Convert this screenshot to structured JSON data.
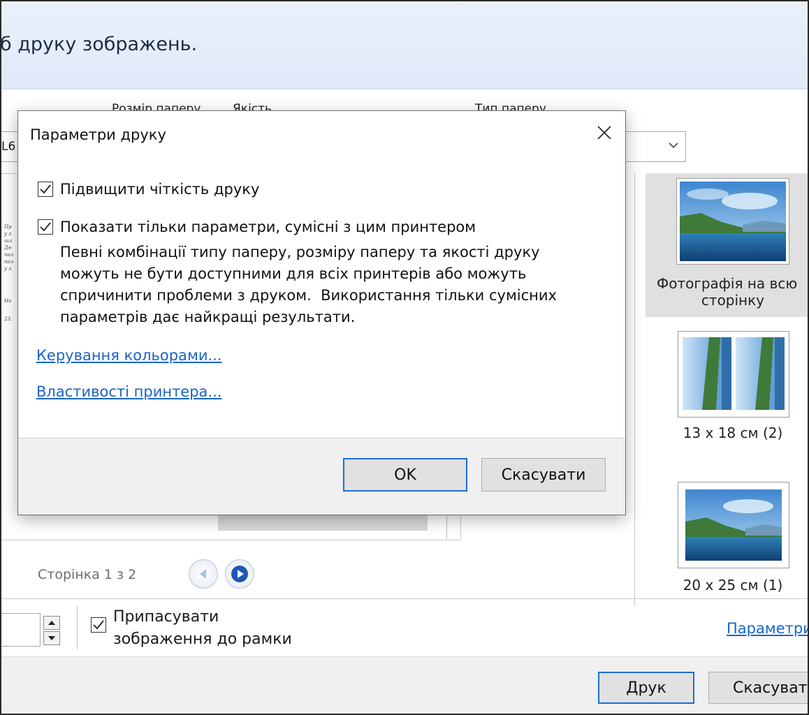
{
  "window": {
    "header_text": "б друку зображень.",
    "paper_size_label": "Розмір паперу",
    "quality_label": "Якість",
    "paper_type_label": "Тип паперу",
    "printer_partial": "L6",
    "page_indicator": "Сторінка 1 з 2",
    "fit_label_line1": "Припасувати",
    "fit_label_line2": "зображення до рамки",
    "fit_checked": true,
    "options_link": "Параметри",
    "print_button": "Друк",
    "cancel_button": "Скасувати",
    "preview_snippets": [
      "Пр",
      "у з",
      "шл",
      "Дн",
      "пол",
      "пол",
      "у з",
      "На",
      "23."
    ]
  },
  "layouts": [
    {
      "caption": "Фотографія на всю сторінку",
      "caption_line1": "Фотографія на всю",
      "caption_line2": "сторінку",
      "selected": true
    },
    {
      "caption": "13 x 18 см (2)",
      "selected": false
    },
    {
      "caption": "20 x 25 см (1)",
      "selected": false
    }
  ],
  "dialog": {
    "title": "Параметри друку",
    "close_icon": "close-icon",
    "option_sharpen": "Підвищити чіткість друку",
    "option_sharpen_checked": true,
    "option_compatible": "Показати тільки параметри, сумісні з цим принтером",
    "option_compatible_checked": true,
    "description_lines": [
      "Певні комбінації типу паперу, розміру паперу та якості друку",
      "можуть не бути доступними для всіх принтерів або можуть",
      "спричинити проблеми з друком.  Використання тільки сумісних",
      "параметрів дає найкращі результати."
    ],
    "link_color_management": "Керування кольорами...",
    "link_printer_properties": "Властивості принтера...",
    "ok_button": "OK",
    "cancel_button": "Скасувати"
  },
  "colors": {
    "accent": "#1a6ed4",
    "link": "#1a64c8",
    "header_band": "#e4ecf8"
  }
}
